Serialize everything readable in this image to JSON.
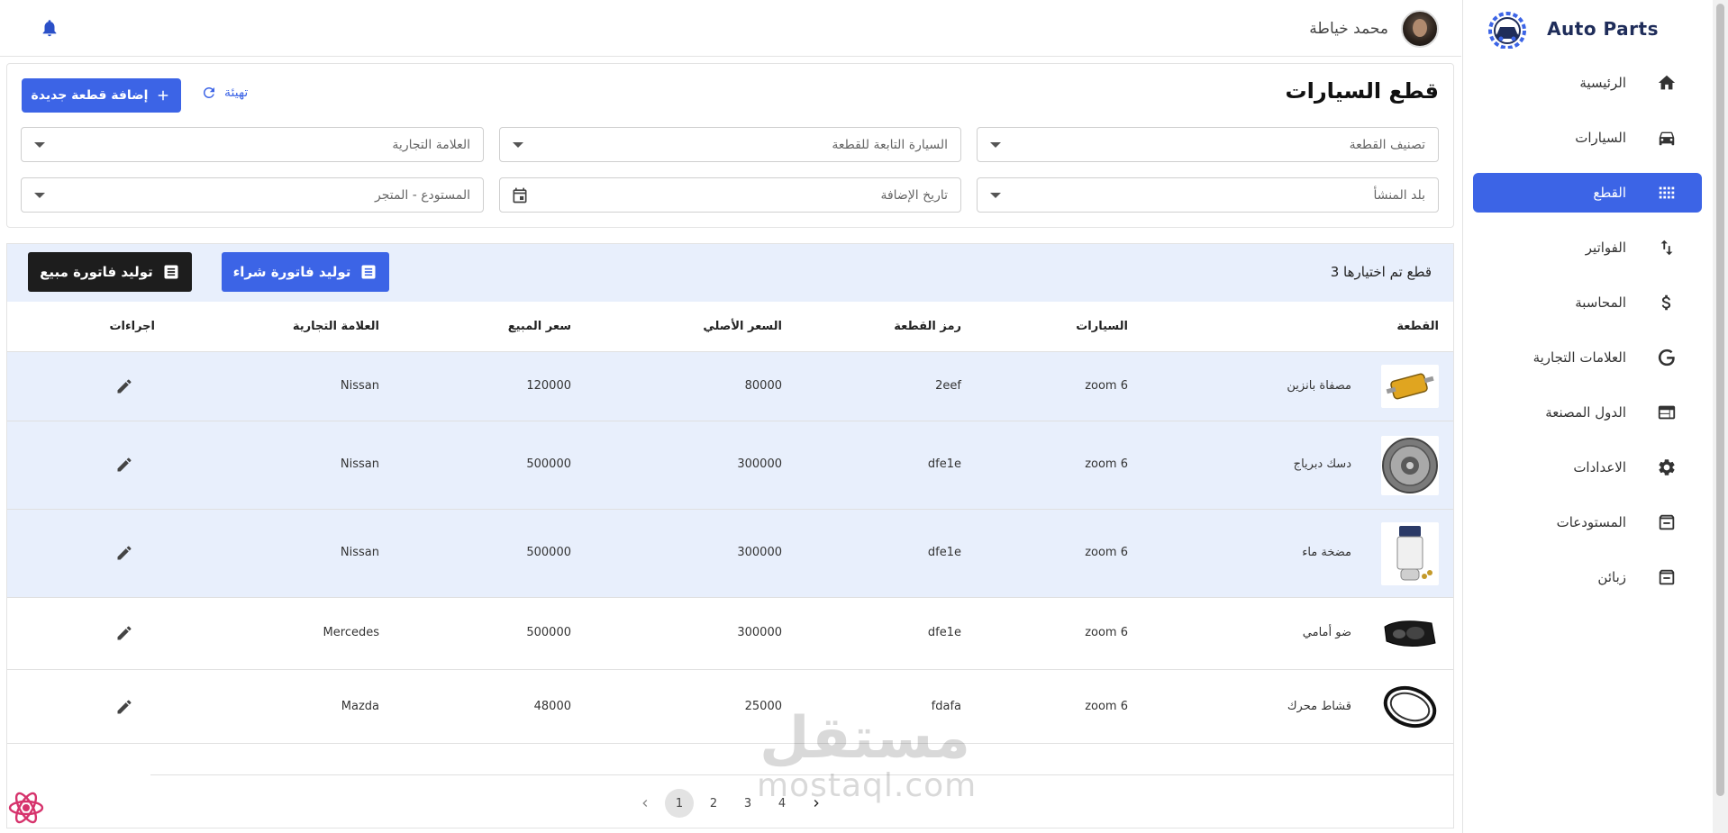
{
  "app": {
    "brand": "Auto Parts"
  },
  "topbar": {
    "user_name": "محمد خياطة"
  },
  "sidebar": {
    "items": [
      {
        "label": "الرئيسية",
        "icon": "home-icon",
        "active": false
      },
      {
        "label": "السيارات",
        "icon": "car-icon",
        "active": false
      },
      {
        "label": "القطع",
        "icon": "grid-icon",
        "active": true
      },
      {
        "label": "الفواتير",
        "icon": "swap-vertical-icon",
        "active": false
      },
      {
        "label": "المحاسبة",
        "icon": "dollar-icon",
        "active": false
      },
      {
        "label": "العلامات التجارية",
        "icon": "google-icon",
        "active": false
      },
      {
        "label": "الدول المصنعة",
        "icon": "web-panel-icon",
        "active": false
      },
      {
        "label": "الاعدادات",
        "icon": "gear-icon",
        "active": false
      },
      {
        "label": "المستودعات",
        "icon": "archive-icon",
        "active": false
      },
      {
        "label": "زبائن",
        "icon": "archive-icon",
        "active": false
      }
    ]
  },
  "filters": {
    "title": "قطع السيارات",
    "add_button": "إضافة قطعة جديدة",
    "reset_button": "تهيئة",
    "part_category": "تصنيف القطعة",
    "part_car": "السيارة التابعة للقطعة",
    "brand": "العلامة التجارية",
    "origin_country": "بلد المنشأ",
    "date_added": "تاريخ الإضافة",
    "warehouse": "المستودع - المتجر"
  },
  "table": {
    "selected_count": "3 قطع تم اختيارها",
    "purchase_invoice_button": "توليد فاتورة شراء",
    "sale_invoice_button": "توليد فاتورة مبيع",
    "columns": {
      "part": "القطعة",
      "cars": "السيارات",
      "part_code": "رمز القطعة",
      "original_price": "السعر الأصلي",
      "sale_price": "سعر المبيع",
      "brand": "العلامة التجارية",
      "actions": "اجراءات"
    },
    "rows": [
      {
        "name": "مصفاة بانزين",
        "cars": "zoom 6",
        "code": "2eef",
        "original_price": "80000",
        "sale_price": "120000",
        "brand": "Nissan",
        "selected": true
      },
      {
        "name": "دسك دبرياج",
        "cars": "zoom 6",
        "code": "dfe1e",
        "original_price": "300000",
        "sale_price": "500000",
        "brand": "Nissan",
        "selected": true
      },
      {
        "name": "مضخة ماء",
        "cars": "zoom 6",
        "code": "dfe1e",
        "original_price": "300000",
        "sale_price": "500000",
        "brand": "Nissan",
        "selected": true
      },
      {
        "name": "ضو أمامي",
        "cars": "zoom 6",
        "code": "dfe1e",
        "original_price": "300000",
        "sale_price": "500000",
        "brand": "Mercedes",
        "selected": false
      },
      {
        "name": "قشاط محرك",
        "cars": "zoom 6",
        "code": "fdafa",
        "original_price": "25000",
        "sale_price": "48000",
        "brand": "Mazda",
        "selected": false
      }
    ]
  },
  "pagination": {
    "pages": [
      "1",
      "2",
      "3",
      "4"
    ],
    "current": "1"
  },
  "watermark": {
    "arabic": "مستقل",
    "latin": "mostaql.com"
  },
  "colors": {
    "accent": "#3c64e6",
    "selected_row": "#e8effc",
    "dark_button": "#1d1d1d"
  }
}
